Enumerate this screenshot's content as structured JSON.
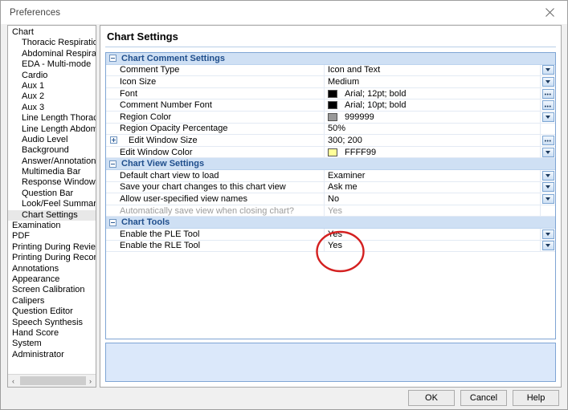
{
  "window": {
    "title": "Preferences",
    "close_icon": "close-icon"
  },
  "sidebar": {
    "items": [
      {
        "label": "Chart",
        "indent": false,
        "selected": false
      },
      {
        "label": "Thoracic Respiration",
        "indent": true,
        "selected": false
      },
      {
        "label": "Abdominal Respiration",
        "indent": true,
        "selected": false
      },
      {
        "label": "EDA - Multi-mode",
        "indent": true,
        "selected": false
      },
      {
        "label": "Cardio",
        "indent": true,
        "selected": false
      },
      {
        "label": "Aux 1",
        "indent": true,
        "selected": false
      },
      {
        "label": "Aux 2",
        "indent": true,
        "selected": false
      },
      {
        "label": "Aux 3",
        "indent": true,
        "selected": false
      },
      {
        "label": "Line Length Thoracic",
        "indent": true,
        "selected": false
      },
      {
        "label": "Line Length Abdominal",
        "indent": true,
        "selected": false
      },
      {
        "label": "Audio Level",
        "indent": true,
        "selected": false
      },
      {
        "label": "Background",
        "indent": true,
        "selected": false
      },
      {
        "label": "Answer/Annotation Line",
        "indent": true,
        "selected": false
      },
      {
        "label": "Multimedia Bar",
        "indent": true,
        "selected": false
      },
      {
        "label": "Response Window",
        "indent": true,
        "selected": false
      },
      {
        "label": "Question Bar",
        "indent": true,
        "selected": false
      },
      {
        "label": "Look/Feel Summary",
        "indent": true,
        "selected": false
      },
      {
        "label": "Chart Settings",
        "indent": true,
        "selected": true
      },
      {
        "label": "Examination",
        "indent": false,
        "selected": false
      },
      {
        "label": "PDF",
        "indent": false,
        "selected": false
      },
      {
        "label": "Printing During Review",
        "indent": false,
        "selected": false
      },
      {
        "label": "Printing During Recording",
        "indent": false,
        "selected": false
      },
      {
        "label": "Annotations",
        "indent": false,
        "selected": false
      },
      {
        "label": "Appearance",
        "indent": false,
        "selected": false
      },
      {
        "label": "Screen Calibration",
        "indent": false,
        "selected": false
      },
      {
        "label": "Calipers",
        "indent": false,
        "selected": false
      },
      {
        "label": "Question Editor",
        "indent": false,
        "selected": false
      },
      {
        "label": "Speech Synthesis",
        "indent": false,
        "selected": false
      },
      {
        "label": "Hand Score",
        "indent": false,
        "selected": false
      },
      {
        "label": "System",
        "indent": false,
        "selected": false
      },
      {
        "label": "Administrator",
        "indent": false,
        "selected": false
      }
    ],
    "scroll_left_label": "‹",
    "scroll_right_label": "›"
  },
  "pane": {
    "title": "Chart Settings",
    "rows": [
      {
        "type": "category",
        "name": "Chart Comment Settings",
        "expander": "minus"
      },
      {
        "type": "row",
        "name": "Comment Type",
        "value": "Icon and Text",
        "button": "dropdown"
      },
      {
        "type": "row",
        "name": "Icon Size",
        "value": "Medium",
        "button": "dropdown"
      },
      {
        "type": "row",
        "name": "Font",
        "value": "Arial; 12pt; bold",
        "swatch": "#000000",
        "button": "ellipsis"
      },
      {
        "type": "row",
        "name": "Comment Number Font",
        "value": "Arial; 10pt; bold",
        "swatch": "#000000",
        "button": "ellipsis"
      },
      {
        "type": "row",
        "name": "Region Color",
        "value": "999999",
        "swatch": "#999999",
        "button": "dropdown"
      },
      {
        "type": "row",
        "name": "Region Opacity Percentage",
        "value": "50%",
        "button": "none"
      },
      {
        "type": "row",
        "name": "Edit Window Size",
        "value": "300; 200",
        "expander": "plus",
        "button": "ellipsis"
      },
      {
        "type": "row",
        "name": "Edit Window Color",
        "value": "FFFF99",
        "swatch": "#FFFF99",
        "button": "dropdown"
      },
      {
        "type": "category",
        "name": "Chart View Settings",
        "expander": "minus"
      },
      {
        "type": "row",
        "name": "Default chart view to load",
        "value": "Examiner",
        "button": "dropdown"
      },
      {
        "type": "row",
        "name": "Save your chart changes to this chart view",
        "value": "Ask me",
        "button": "dropdown"
      },
      {
        "type": "row",
        "name": "Allow user-specified view names",
        "value": "No",
        "button": "dropdown"
      },
      {
        "type": "row",
        "name": "Automatically save view when closing chart?",
        "value": "Yes",
        "disabled": true,
        "button": "none"
      },
      {
        "type": "category",
        "name": "Chart Tools",
        "expander": "minus"
      },
      {
        "type": "row",
        "name": "Enable the PLE Tool",
        "value": "Yes",
        "button": "dropdown"
      },
      {
        "type": "row",
        "name": "Enable the RLE Tool",
        "value": "Yes",
        "button": "dropdown"
      }
    ],
    "description": ""
  },
  "footer": {
    "ok_label": "OK",
    "cancel_label": "Cancel",
    "help_label": "Help"
  },
  "annotation": {
    "shape": "red-ellipse-highlight",
    "color": "#d42020"
  }
}
